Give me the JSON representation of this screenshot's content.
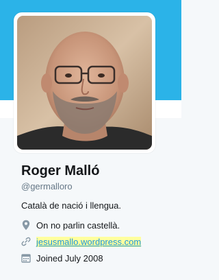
{
  "profile": {
    "name": "Roger Malló",
    "handle": "@germalloro",
    "bio": "Català de nació i llengua.",
    "location": "On no parlin castellà.",
    "website": "jesusmallo.wordpress.com",
    "joined": "Joined July 2008"
  },
  "icons": {
    "location": "map-pin-icon",
    "website": "link-icon",
    "joined": "calendar-icon"
  },
  "colors": {
    "banner": "#2bb3e8",
    "link": "#1b95e0",
    "link_highlight": "#ffff9e",
    "text": "#14171a",
    "muted": "#657786"
  }
}
